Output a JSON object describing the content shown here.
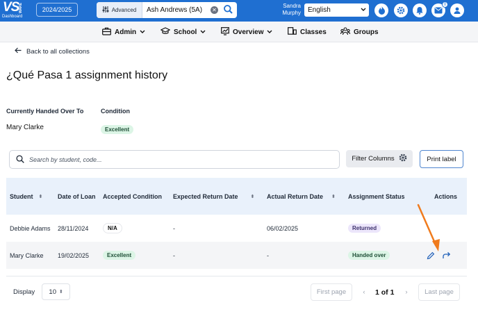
{
  "topbar": {
    "logo_text": "VS",
    "logo_sub": "WARE",
    "dashboard_label": "Dashboard",
    "year": "2024/2025",
    "advanced_label": "Advanced",
    "search_value": "Ash Andrews (5A)",
    "user_first": "Sandra",
    "user_last": "Murphy",
    "language": "English",
    "mail_badge": "0",
    "icons": [
      "fire-icon",
      "gear-icon",
      "bell-icon",
      "mail-icon",
      "user-icon"
    ],
    "brand_color": "#1f6fd1"
  },
  "nav": {
    "items": [
      {
        "label": "Admin",
        "icon": "briefcase-icon",
        "has_dropdown": true
      },
      {
        "label": "School",
        "icon": "graduation-cap-icon",
        "has_dropdown": true
      },
      {
        "label": "Overview",
        "icon": "chart-icon",
        "has_dropdown": true
      },
      {
        "label": "Classes",
        "icon": "classes-icon",
        "has_dropdown": false
      },
      {
        "label": "Groups",
        "icon": "groups-icon",
        "has_dropdown": false
      }
    ]
  },
  "page": {
    "back_label": "Back to all collections",
    "title": "¿Qué Pasa 1 assignment history",
    "handed_over_label": "Currently Handed Over To",
    "condition_label": "Condition",
    "handed_over_to": "Mary Clarke",
    "condition": "Excellent"
  },
  "toolbar": {
    "search_placeholder": "Search by student, code...",
    "filter_label": "Filter Columns",
    "print_label": "Print label"
  },
  "table": {
    "columns": [
      "Student",
      "Date of Loan",
      "Accepted Condition",
      "Expected Return Date",
      "Actual Return Date",
      "Assignment Status",
      "Actions"
    ],
    "rows": [
      {
        "student": "Debbie Adams",
        "date_of_loan": "28/11/2024",
        "accepted_condition": "N/A",
        "expected_return": "-",
        "actual_return": "06/02/2025",
        "status": "Returned"
      },
      {
        "student": "Mary Clarke",
        "date_of_loan": "19/02/2025",
        "accepted_condition": "Excellent",
        "expected_return": "-",
        "actual_return": "-",
        "status": "Handed over"
      }
    ]
  },
  "pagination": {
    "display_label": "Display",
    "page_size": "10",
    "first_label": "First page",
    "page_info": "1 of 1",
    "last_label": "Last page"
  },
  "annotation": {
    "color": "#f07b1d"
  }
}
